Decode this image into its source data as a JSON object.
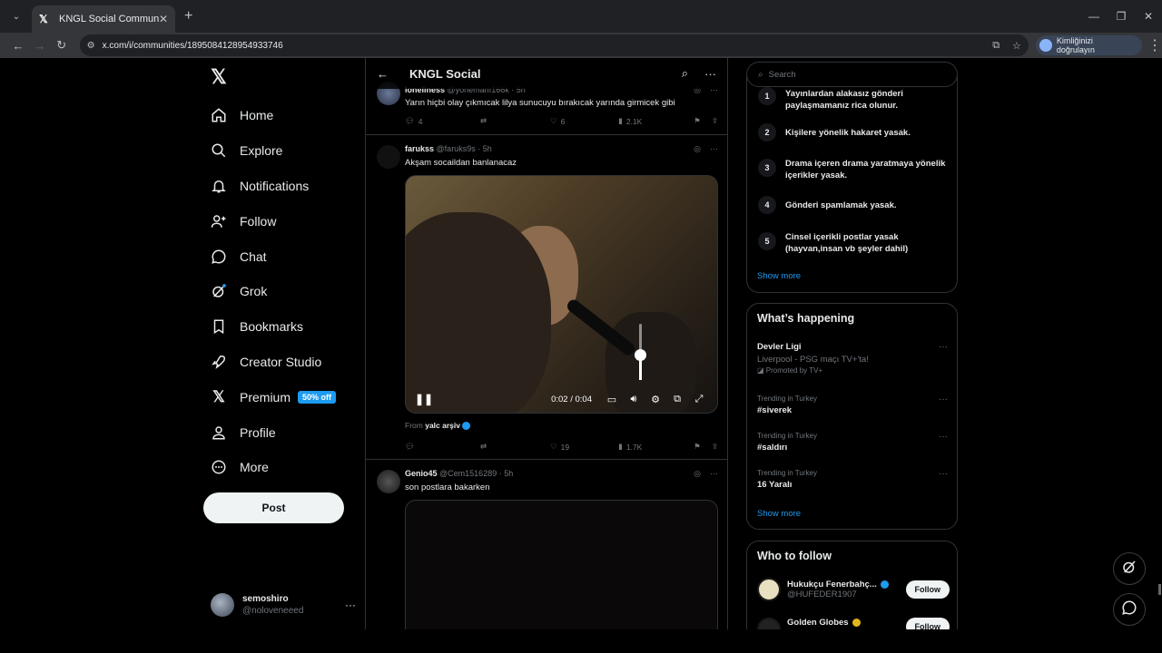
{
  "browser": {
    "tab_title": "KNGL Social Community / X",
    "tab_close": "✕",
    "new_tab": "+",
    "url": "x.com/i/communities/1895084128954933746",
    "profile_label": "Kimliğinizi doğrulayın",
    "min": "—",
    "restore": "❐",
    "close": "✕"
  },
  "sidebar": {
    "logo": "𝕏",
    "items": [
      {
        "label": "Home",
        "icon": "home-icon"
      },
      {
        "label": "Explore",
        "icon": "search-icon"
      },
      {
        "label": "Notifications",
        "icon": "bell-icon"
      },
      {
        "label": "Follow",
        "icon": "person-plus-icon"
      },
      {
        "label": "Chat",
        "icon": "chat-icon"
      },
      {
        "label": "Grok",
        "icon": "grok-icon"
      },
      {
        "label": "Bookmarks",
        "icon": "bookmark-icon"
      },
      {
        "label": "Creator Studio",
        "icon": "rocket-icon"
      },
      {
        "label": "Premium",
        "icon": "x-icon",
        "badge": "50% off"
      },
      {
        "label": "Profile",
        "icon": "person-icon"
      },
      {
        "label": "More",
        "icon": "more-circle-icon"
      }
    ],
    "post_button": "Post",
    "user": {
      "name": "semoshiro",
      "handle": "@noloveneeed",
      "more": "···"
    }
  },
  "main": {
    "title": "KNGL Social",
    "posts": [
      {
        "author": "loneliness",
        "handle": "@yonemanı166k · 5h",
        "text": "Yarın hiçbi olay çıkmıcak lilya sunucuyu bırakıcak yarında girmicek gibi",
        "replies": "4",
        "reposts": "",
        "likes": "6",
        "views": "2.1K"
      },
      {
        "author": "farukss",
        "handle": "@faruks9s · 5h",
        "text": "Akşam socaildan banlanacaz",
        "video_time": "0:02 / 0:04",
        "from_label": "From",
        "from_source": "yalc arşiv",
        "volume": 0.45,
        "replies": "",
        "reposts": "",
        "likes": "19",
        "views": "1.7K"
      },
      {
        "author": "Genio45",
        "handle": "@Cem1516289 · 5h",
        "text": "son postlara bakarken"
      }
    ]
  },
  "right": {
    "search_placeholder": "Search",
    "rules": [
      {
        "n": "1",
        "text": "Yayınlardan alakasız gönderi paylaşmamanız rica olunur."
      },
      {
        "n": "2",
        "text": "Kişilere yönelik hakaret yasak."
      },
      {
        "n": "3",
        "text": "Drama içeren drama yaratmaya yönelik içerikler yasak."
      },
      {
        "n": "4",
        "text": "Gönderi spamlamak yasak."
      },
      {
        "n": "5",
        "text": "Cinsel içerikli postlar yasak (hayvan,insan vb şeyler dahil)"
      }
    ],
    "rules_show_more": "Show more",
    "happening_title": "What’s happening",
    "trends": [
      {
        "context": "",
        "name": "Devler Ligi",
        "desc": "Liverpool - PSG maçı TV+'ta!",
        "promo": "Promoted by TV+"
      },
      {
        "context": "Trending in Turkey",
        "name": "#siverek"
      },
      {
        "context": "Trending in Turkey",
        "name": "#saldırı"
      },
      {
        "context": "Trending in Turkey",
        "name": "16 Yaralı"
      }
    ],
    "trends_show_more": "Show more",
    "who_to_follow_title": "Who to follow",
    "follow": [
      {
        "name": "Hukukçu Fenerbahç...",
        "handle": "@HUFEDER1907",
        "button": "Follow"
      },
      {
        "name": "Golden Globes",
        "handle": "",
        "button": "Follow"
      }
    ]
  }
}
